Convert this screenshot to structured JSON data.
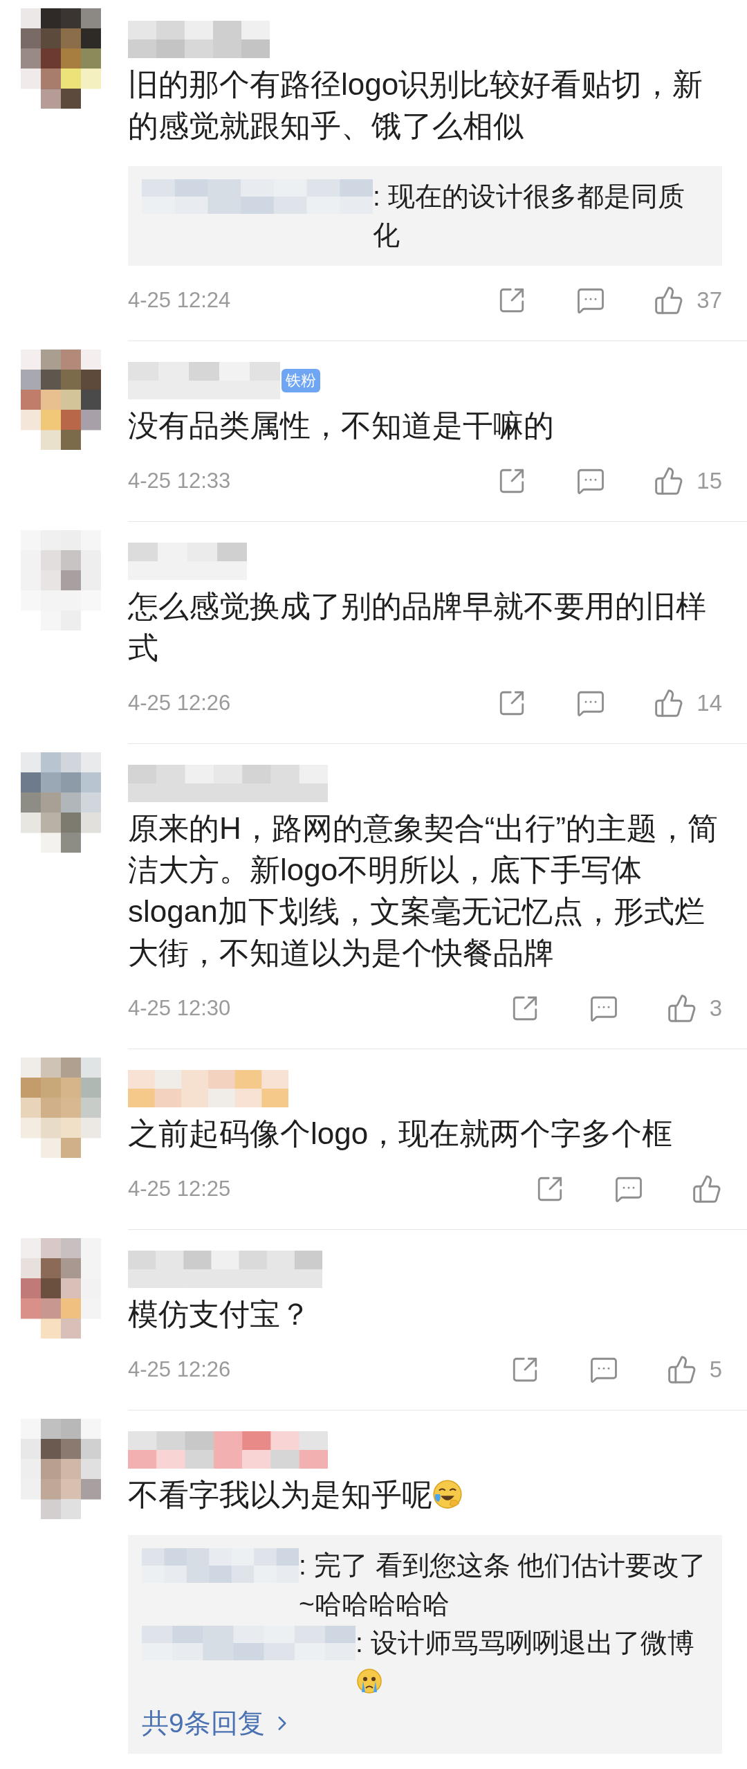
{
  "comments": [
    {
      "kind": "plain",
      "text": "旧的那个有路径logo识别比较好看贴切，新的感觉就跟知乎、饿了么相似",
      "replies": [
        {
          "kind": "plain",
          "text": ": 现在的设计很多都是同质化"
        }
      ],
      "time": "4-25 12:24",
      "likes": "37"
    },
    {
      "kind": "plain",
      "badge": "铁粉",
      "text": "没有品类属性，不知道是干嘛的",
      "time": "4-25 12:33",
      "likes": "15"
    },
    {
      "kind": "plain",
      "text": "怎么感觉换成了别的品牌早就不要用的旧样式",
      "time": "4-25 12:26",
      "likes": "14"
    },
    {
      "kind": "plain",
      "text": "原来的H，路网的意象契合“出行”的主题，简洁大方。新logo不明所以，底下手写体slogan加下划线，文案毫无记忆点，形式烂大街，不知道以为是个快餐品牌",
      "time": "4-25 12:30",
      "likes": "3"
    },
    {
      "kind": "plain",
      "text": "之前起码像个logo，现在就两个字多个框",
      "time": "4-25 12:25"
    },
    {
      "kind": "plain",
      "text": "模仿支付宝？",
      "time": "4-25 12:26",
      "likes": "5"
    },
    {
      "kind": "laughing",
      "text": "不看字我以为是知乎呢",
      "replies": [
        {
          "kind": "plain",
          "text": ": 完了 看到您这条 他们估计要改了 ~哈哈哈哈哈"
        },
        {
          "kind": "crying",
          "text": ": 设计师骂骂咧咧退出了微博"
        }
      ],
      "more": "共9条回复"
    }
  ]
}
